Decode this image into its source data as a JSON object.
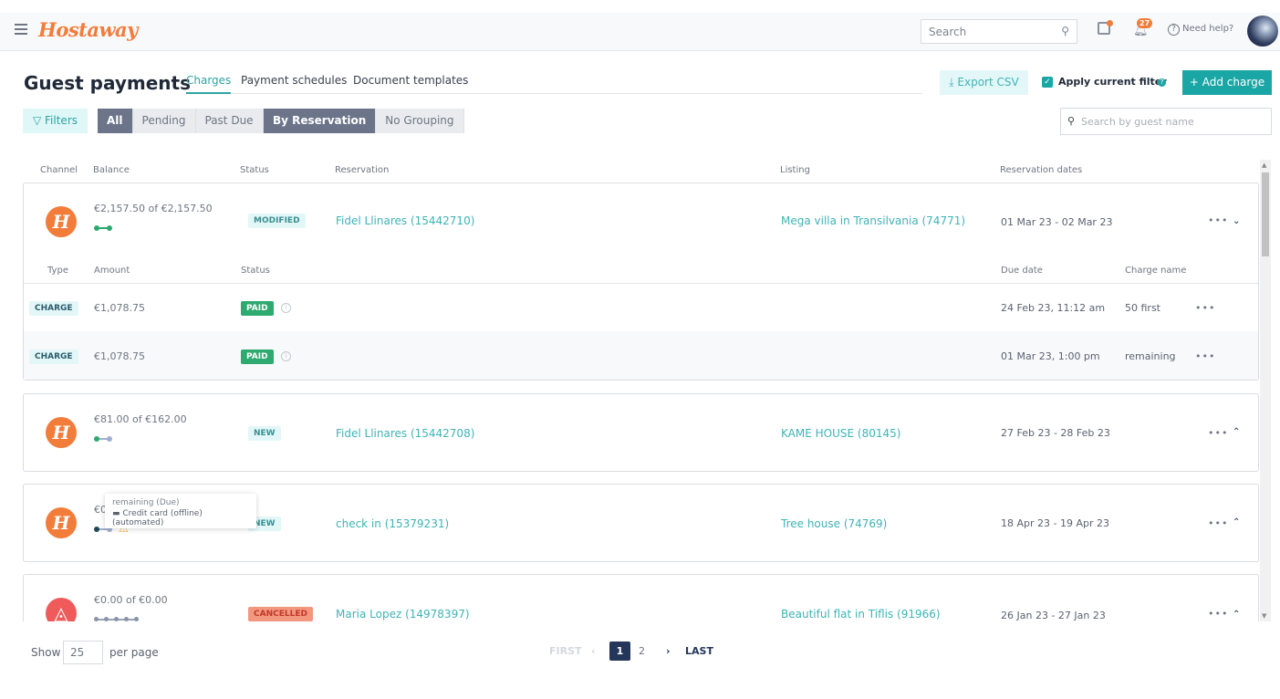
{
  "app": {
    "logo": "Hostaway",
    "global_search_placeholder": "Search",
    "notifications_count": "27",
    "help_label": "Need help?"
  },
  "page": {
    "title": "Guest payments"
  },
  "tabs": [
    {
      "label": "Charges",
      "active": true
    },
    {
      "label": "Payment schedules"
    },
    {
      "label": "Document templates"
    }
  ],
  "actions": {
    "export_label": "Export CSV",
    "apply_filter_label": "Apply current filter",
    "apply_filter_checked": true,
    "add_charge_label": "+ Add charge"
  },
  "filters": {
    "filters_label": "Filters",
    "status_segments": [
      "All",
      "Pending",
      "Past Due"
    ],
    "status_selected": "All",
    "grouping_segments": [
      "By Reservation",
      "No Grouping"
    ],
    "grouping_selected": "By Reservation",
    "guest_search_placeholder": "Search by guest name"
  },
  "columns": [
    "Channel",
    "Balance",
    "Status",
    "Reservation",
    "Listing",
    "Reservation dates"
  ],
  "sub_columns": [
    "Type",
    "Amount",
    "Status",
    "Due date",
    "Charge name"
  ],
  "reservations": [
    {
      "channel": "hostaway",
      "balance": "€2,157.50 of €2,157.50",
      "status": "MODIFIED",
      "reservation": "Fidel Llinares (15442710)",
      "listing": "Mega villa in Transilvania (74771)",
      "dates": "01 Mar 23 - 02 Mar 23",
      "expanded": true,
      "charges": [
        {
          "type": "CHARGE",
          "amount": "€1,078.75",
          "status": "PAID",
          "due_date": "24 Feb 23, 11:12 am",
          "charge_name": "50 first"
        },
        {
          "type": "CHARGE",
          "amount": "€1,078.75",
          "status": "PAID",
          "due_date": "01 Mar 23, 1:00 pm",
          "charge_name": "remaining"
        }
      ]
    },
    {
      "channel": "hostaway",
      "balance": "€81.00 of €162.00",
      "status": "NEW",
      "reservation": "Fidel Llinares (15442708)",
      "listing": "KAME HOUSE (80145)",
      "dates": "27 Feb 23 - 28 Feb 23",
      "expanded": false
    },
    {
      "channel": "hostaway",
      "balance": "€0",
      "status": "NEW",
      "reservation": "check in (15379231)",
      "listing": "Tree house (74769)",
      "dates": "18 Apr 23 - 19 Apr 23",
      "expanded": false,
      "warning": true
    },
    {
      "channel": "airbnb",
      "balance": "€0.00 of €0.00",
      "status": "CANCELLED",
      "reservation": "Maria Lopez (14978397)",
      "listing": "Beautiful flat in Tiflis (91966)",
      "dates": "26 Jan 23 - 27 Jan 23",
      "expanded": false
    }
  ],
  "tooltip": {
    "line1": "remaining  (Due)",
    "line2": "Credit card (offline) (automated)"
  },
  "pagination": {
    "show_label": "Show",
    "per_page_value": "25",
    "per_page_label": "per page",
    "first": "FIRST",
    "current": "1",
    "pages": [
      "1",
      "2"
    ],
    "last": "LAST"
  },
  "colors": {
    "brand": "#f27c3a",
    "accent": "#1aa6a5",
    "paid": "#2ea96f",
    "cancelled": "#f3977f"
  }
}
